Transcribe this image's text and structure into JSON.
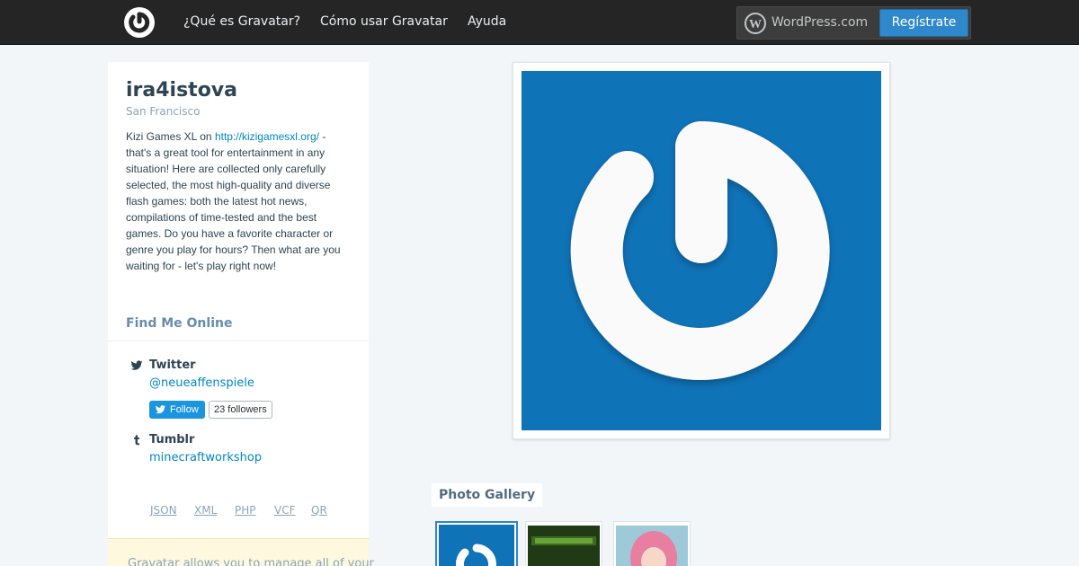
{
  "nav": {
    "links": [
      "¿Qué es Gravatar?",
      "Cómo usar Gravatar",
      "Ayuda"
    ],
    "wordpress_label": "WordPress.com",
    "signup_label": "Regístrate"
  },
  "profile": {
    "name": "ira4istova",
    "location": "San Francisco",
    "bio_prefix": "Kizi Games XL on ",
    "bio_link": "http://kizigamesxl.org/",
    "bio_suffix": " - that's a great tool for entertainment in any situation! Here are collected only carefully selected, the most high-quality and diverse flash games: both the latest hot news, compilations of time-tested and the best games. Do you have a favorite character or genre you play for hours? Then what are you waiting for - let's play right now!"
  },
  "find_me": {
    "heading": "Find Me Online",
    "accounts": [
      {
        "service": "Twitter",
        "handle": "@neueaffenspiele",
        "icon": "twitter-icon"
      },
      {
        "service": "Tumblr",
        "handle": "minecraftworkshop",
        "icon": "tumblr-icon"
      }
    ],
    "follow_label": "Follow",
    "followers_label": "23 followers"
  },
  "formats": [
    "JSON",
    "XML",
    "PHP",
    "VCF",
    "QR"
  ],
  "notice": {
    "text": "Gravatar allows you to manage all of your"
  },
  "gallery": {
    "label": "Photo Gallery",
    "thumbs": [
      "gravatar-logo-thumb",
      "minecraft-thumb",
      "anime-character-thumb"
    ]
  },
  "colors": {
    "topbar": "#252525",
    "accent": "#2f88cb",
    "link": "#0087be",
    "avatar_bg": "#0f73b8"
  }
}
